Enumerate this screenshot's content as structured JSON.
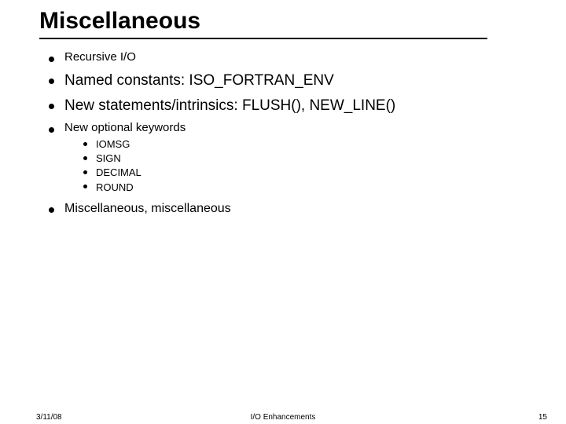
{
  "title": "Miscellaneous",
  "bullets": {
    "b1": "Recursive I/O",
    "b2": "Named constants: ISO_FORTRAN_ENV",
    "b3": "New statements/intrinsics: FLUSH(), NEW_LINE()",
    "b4": "New optional keywords",
    "sub": {
      "s1": "IOMSG",
      "s2": "SIGN",
      "s3": "DECIMAL",
      "s4": "ROUND"
    },
    "b5": "Miscellaneous, miscellaneous"
  },
  "footer": {
    "date": "3/11/08",
    "center": "I/O Enhancements",
    "page": "15"
  }
}
